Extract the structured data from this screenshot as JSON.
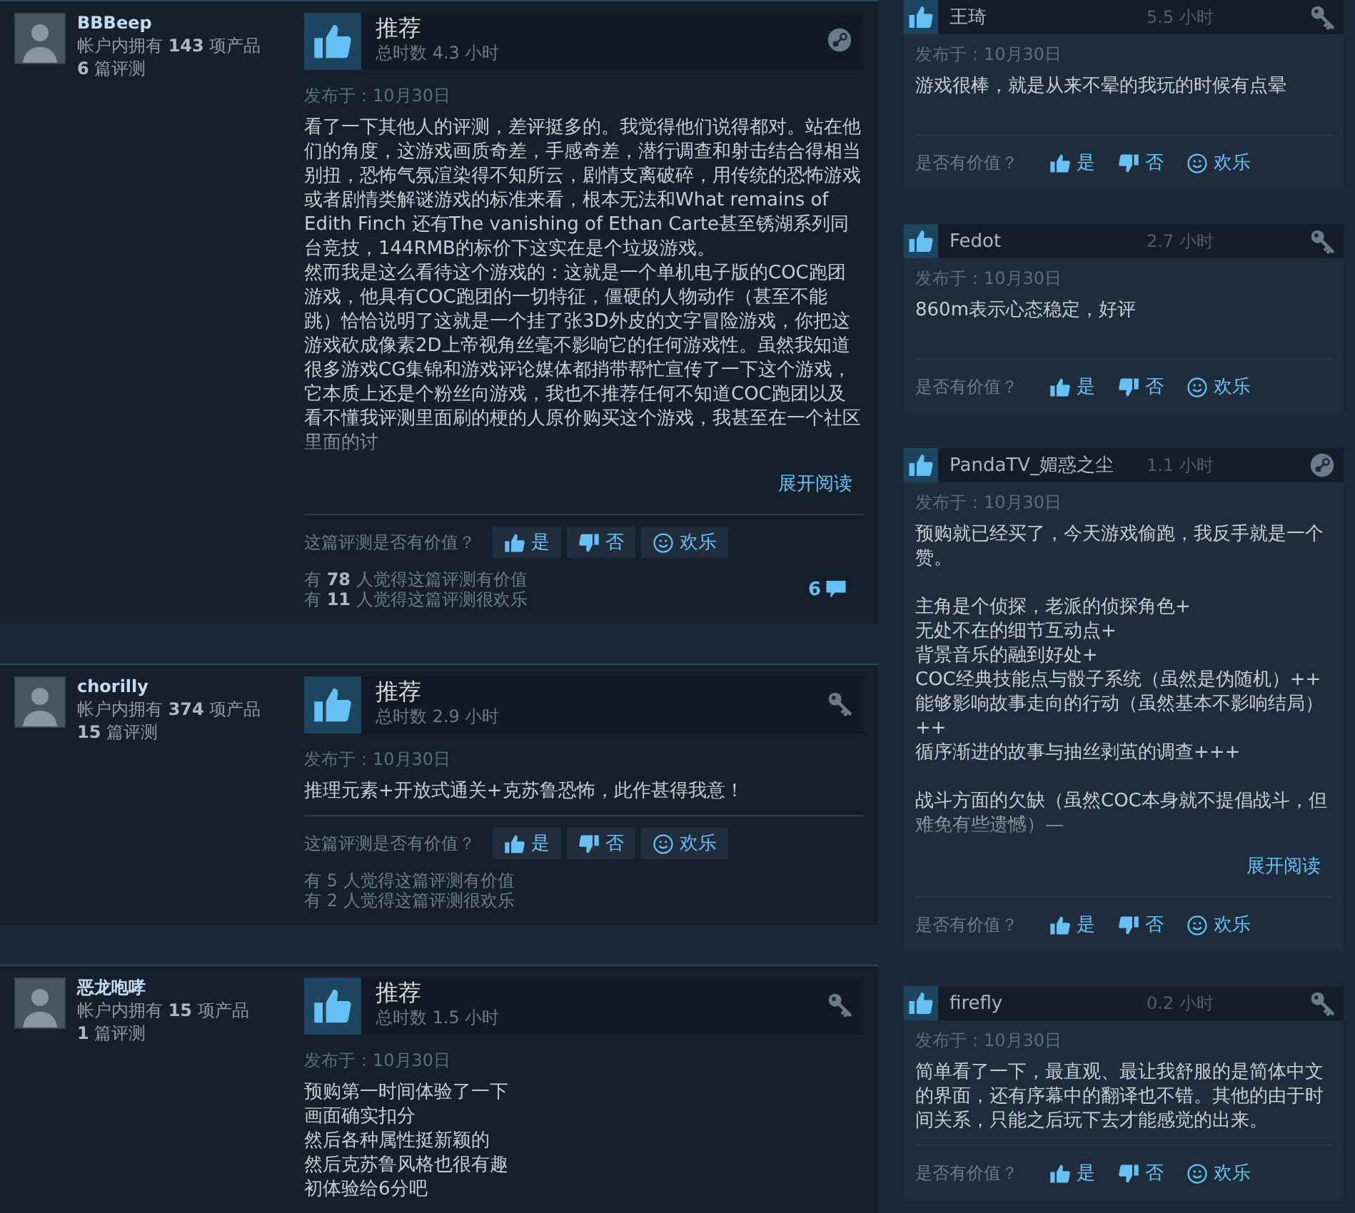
{
  "reviews": [
    {
      "author": "BBBeep",
      "products": "帐户内拥有 **143** 项产品",
      "review_count": "**6** 篇评测",
      "verdict": "推荐",
      "hours": "总时数 4.3 小时",
      "kind": "steam",
      "posted": "发布于：10月30日",
      "paragraphs": [
        [
          "看了一下其他人的评测，差评挺多的。我觉得他们说得都对。站在他们的角度，这游戏画质奇差，手感奇差，潜行调查和射击结合得相当别扭，恐怖气氛渲染得不知所云，剧情支离破碎，用传统的恐怖游戏或者剧情类解谜游戏的标准来看，根本无法和What remains of Edith Finch 还有The vanishing of Ethan Carte甚至锈湖系列同台竞技，144RMB的标价下这实在是个垃圾游戏。",
          "然而我是这么看待这个游戏的：这就是一个单机电子版的COC跑团游戏，他具有COC跑团的一切特征，僵硬的人物动作（甚至不能跳）恰恰说明了这就是一个挂了张3D外皮的文字冒险游戏，你把这游戏砍成像素2D上帝视角丝毫不影响它的任何游戏性。虽然我知道很多游戏CG集锦和游戏评论媒体都捎带帮忙宣传了一下这个游戏，它本质上还是个粉丝向游戏，我也不推荐任何不知道COC跑团以及看不懂我评测里面刷的梗的人原价购买这个游戏，我甚至在一个社区里面的讨"
        ]
      ],
      "expand": "展开阅读",
      "helpful_prompt": "这篇评测是否有价值？",
      "buttons": [
        {
          "kind": "yes",
          "label": "是"
        },
        {
          "kind": "no",
          "label": "否"
        },
        {
          "kind": "funny",
          "label": "欢乐"
        }
      ],
      "stats": [
        "有 **78** 人觉得这篇评测有价值",
        "有 **11** 人觉得这篇评测很欢乐"
      ],
      "comments": "6"
    },
    {
      "author": "chorilly",
      "products": "帐户内拥有 **374** 项产品",
      "review_count": "**15** 篇评测",
      "verdict": "推荐",
      "hours": "总时数 2.9 小时",
      "kind": "key",
      "posted": "发布于：10月30日",
      "paragraphs": [
        [
          "推理元素+开放式通关+克苏鲁恐怖，此作甚得我意！"
        ]
      ],
      "helpful_prompt": "这篇评测是否有价值？",
      "buttons": [
        {
          "kind": "yes",
          "label": "是"
        },
        {
          "kind": "no",
          "label": "否"
        },
        {
          "kind": "funny",
          "label": "欢乐"
        }
      ],
      "stats": [
        "有 5 人觉得这篇评测有价值",
        "有 2 人觉得这篇评测很欢乐"
      ]
    },
    {
      "author": "恶龙咆哮",
      "products": "帐户内拥有 **15** 项产品",
      "review_count": "**1** 篇评测",
      "verdict": "推荐",
      "hours": "总时数 1.5 小时",
      "kind": "key",
      "posted": "发布于：10月30日",
      "paragraphs": [
        [
          "预购第一时间体验了一下",
          "画面确实扣分",
          "然后各种属性挺新颖的",
          "然后克苏鲁风格也很有趣",
          "初体验给6分吧"
        ]
      ]
    }
  ],
  "side_reviews": [
    {
      "author": "王琦",
      "hours": "5.5 小时",
      "kind": "key",
      "posted": "发布于：10月30日",
      "paragraphs": [
        [
          "游戏很棒，就是从来不晕的我玩的时候有点晕"
        ]
      ],
      "helpful_prompt": "是否有价值？",
      "buttons": [
        {
          "kind": "yes",
          "label": "是"
        },
        {
          "kind": "no",
          "label": "否"
        },
        {
          "kind": "funny",
          "label": "欢乐"
        }
      ]
    },
    {
      "author": "Fedot",
      "hours": "2.7 小时",
      "kind": "key",
      "posted": "发布于：10月30日",
      "paragraphs": [
        [
          "860m表示心态稳定，好评"
        ]
      ],
      "helpful_prompt": "是否有价值？",
      "buttons": [
        {
          "kind": "yes",
          "label": "是"
        },
        {
          "kind": "no",
          "label": "否"
        },
        {
          "kind": "funny",
          "label": "欢乐"
        }
      ]
    },
    {
      "author": "PandaTV_媚惑之尘",
      "hours": "1.1 小时",
      "kind": "steam",
      "posted": "发布于：10月30日",
      "paragraphs": [
        [
          "预购就已经买了，今天游戏偷跑，我反手就是一个赞。"
        ],
        [
          "主角是个侦探，老派的侦探角色+",
          "无处不在的细节互动点+",
          "背景音乐的融到好处+",
          "COC经典技能点与骰子系统（虽然是伪随机）++",
          "能够影响故事走向的行动（虽然基本不影响结局）++",
          "循序渐进的故事与抽丝剥茧的调查+++"
        ],
        [
          "战斗方面的欠缺（虽然COC本身就不提倡战斗，但难免有些遗憾）—"
        ]
      ],
      "expand": "展开阅读",
      "helpful_prompt": "是否有价值？",
      "buttons": [
        {
          "kind": "yes",
          "label": "是"
        },
        {
          "kind": "no",
          "label": "否"
        },
        {
          "kind": "funny",
          "label": "欢乐"
        }
      ]
    },
    {
      "author": "firefly",
      "hours": "0.2 小时",
      "kind": "key",
      "posted": "发布于：10月30日",
      "paragraphs": [
        [
          "简单看了一下，最直观、最让我舒服的是简体中文的界面，还有序幕中的翻译也不错。其他的由于时间关系，只能之后玩下去才能感觉的出来。"
        ]
      ],
      "helpful_prompt": "是否有价值？",
      "buttons": [
        {
          "kind": "yes",
          "label": "是"
        },
        {
          "kind": "no",
          "label": "否"
        },
        {
          "kind": "funny",
          "label": "欢乐"
        }
      ]
    }
  ]
}
